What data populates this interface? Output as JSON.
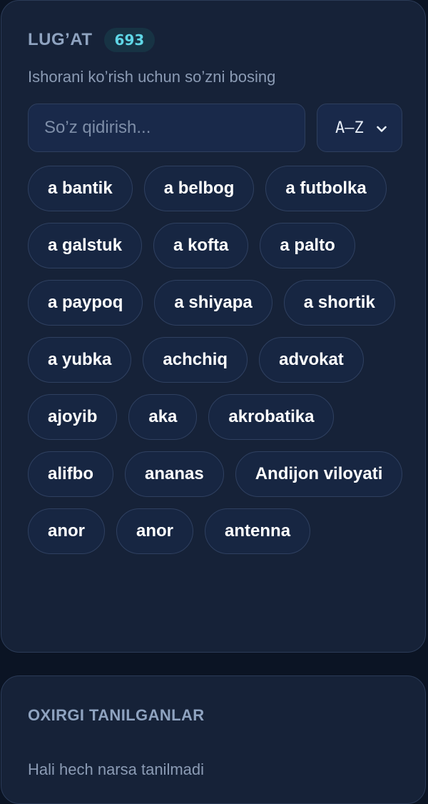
{
  "dictionary": {
    "title": "LUG’AT",
    "count": "693",
    "subtitle": "Ishorani ko’rish uchun so’zni bosing",
    "search": {
      "placeholder": "So’z qidirish...",
      "value": ""
    },
    "sort": {
      "selected": "A–Z"
    },
    "words": [
      "a bantik",
      "a belbog",
      "a futbolka",
      "a galstuk",
      "a kofta",
      "a palto",
      "a paypoq",
      "a shiyapa",
      "a shortik",
      "a yubka",
      "achchiq",
      "advokat",
      "ajoyib",
      "aka",
      "akrobatika",
      "alifbo",
      "ananas",
      "Andijon viloyati",
      "anor",
      "anor",
      "antenna"
    ]
  },
  "recent": {
    "title": "OXIRGI TANILGANLAR",
    "empty_text": "Hali hech narsa tanilmadi"
  },
  "icons": {
    "sort_dropdown": "chevron-down-icon"
  },
  "colors": {
    "background": "#0b1424",
    "card": "#162238",
    "accent": "#5fd6e6",
    "badge_bg": "#173344"
  }
}
